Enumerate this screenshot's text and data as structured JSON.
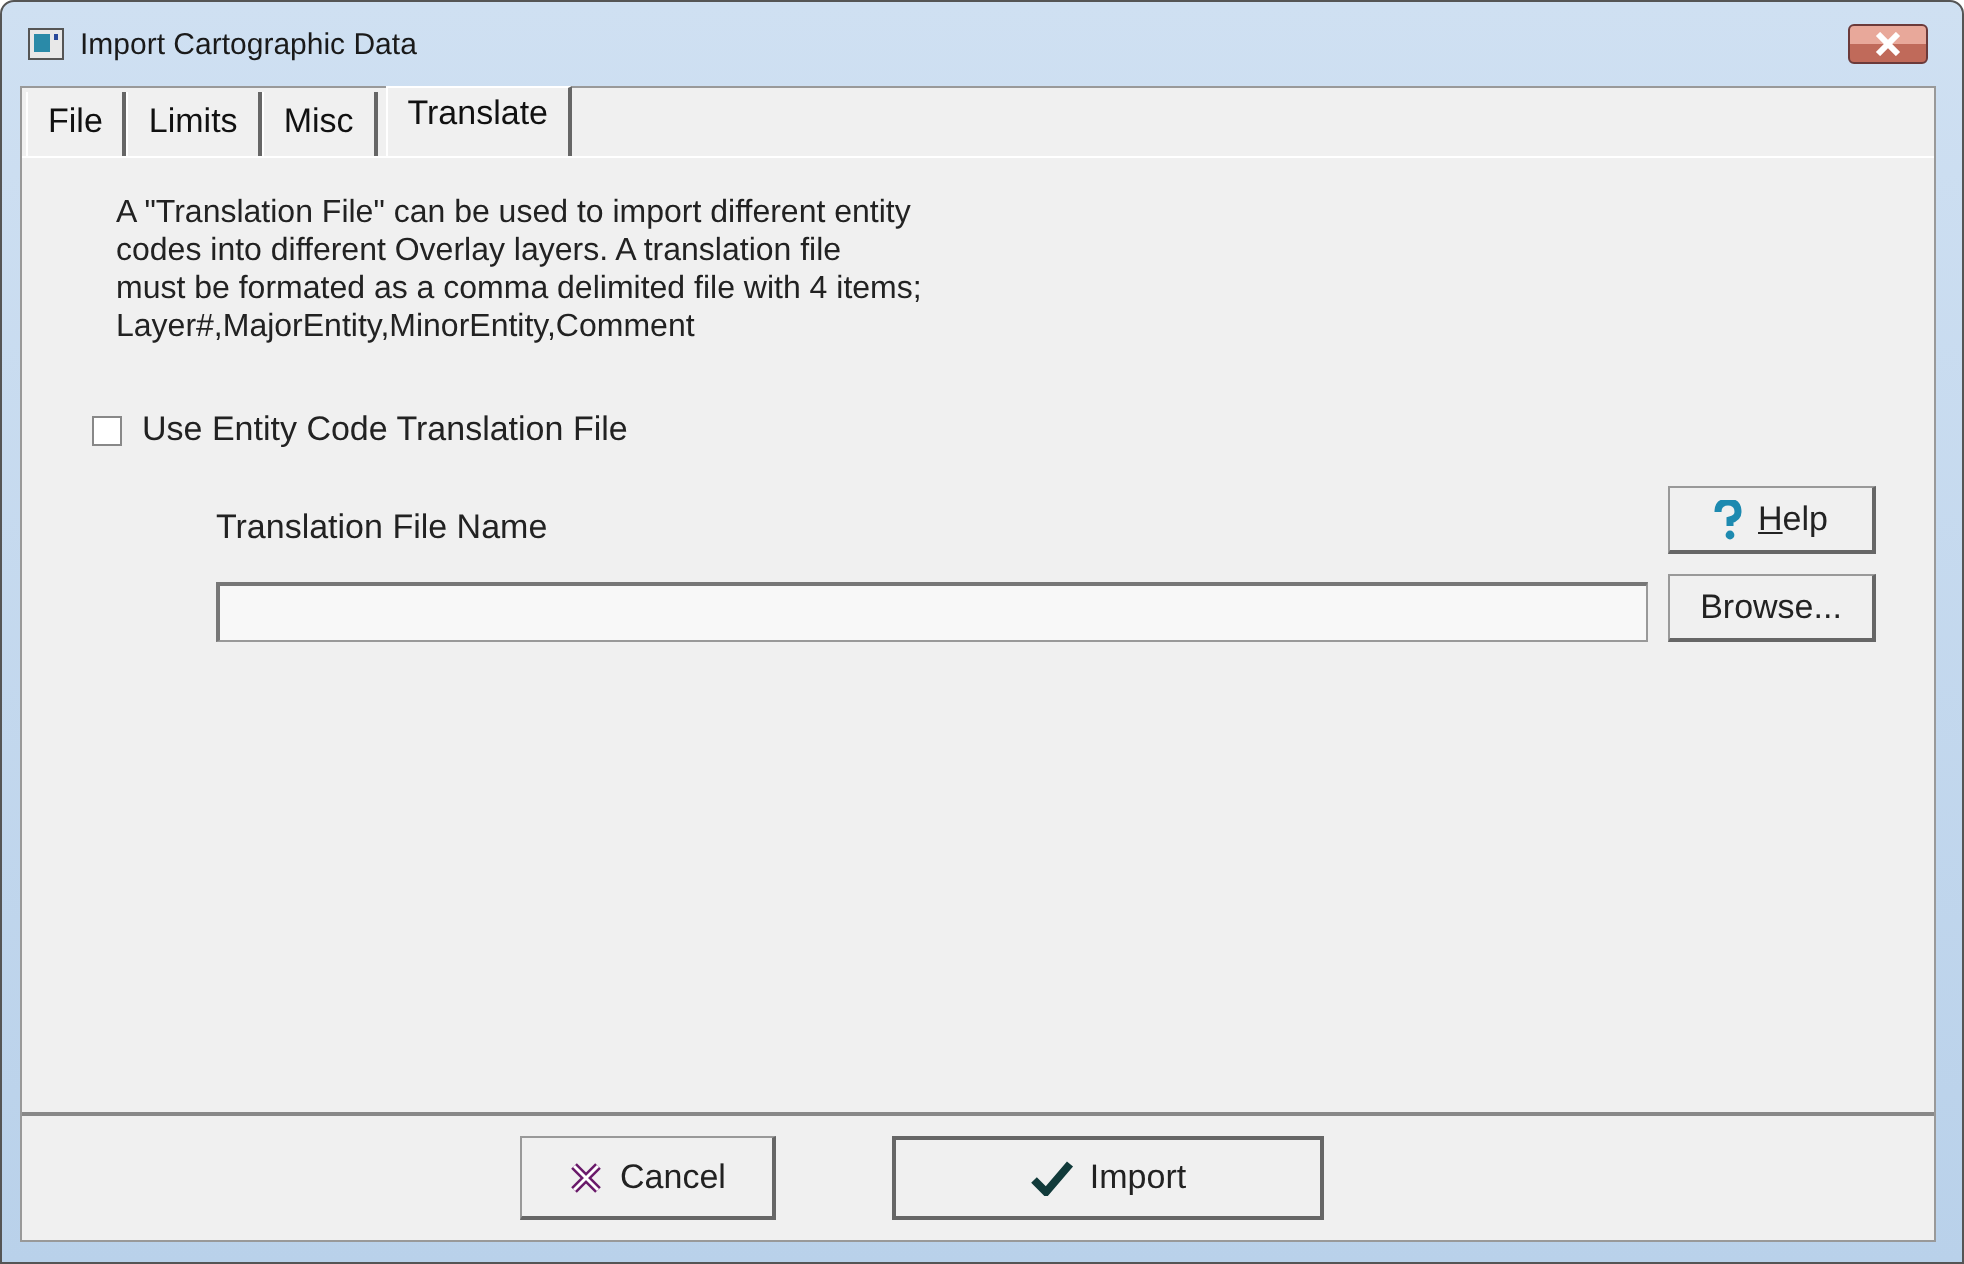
{
  "window": {
    "title": "Import Cartographic Data"
  },
  "tabs": [
    {
      "label": "File",
      "selected": false
    },
    {
      "label": "Limits",
      "selected": false
    },
    {
      "label": "Misc",
      "selected": false
    },
    {
      "label": "Translate",
      "selected": true
    }
  ],
  "description": "A \"Translation File\" can be used to import different entity\ncodes into different Overlay layers. A translation file\nmust be formated as a comma delimited file with 4 items;\nLayer#,MajorEntity,MinorEntity,Comment",
  "use_translation": {
    "label": "Use Entity Code Translation File",
    "checked": false
  },
  "file_name": {
    "label": "Translation File Name"
  },
  "help_button": {
    "mnemonic": "H",
    "label_rest": "elp"
  },
  "browse_button": {
    "label": "Browse..."
  },
  "cancel_button": {
    "label": "Cancel"
  },
  "import_button": {
    "label": "Import"
  }
}
